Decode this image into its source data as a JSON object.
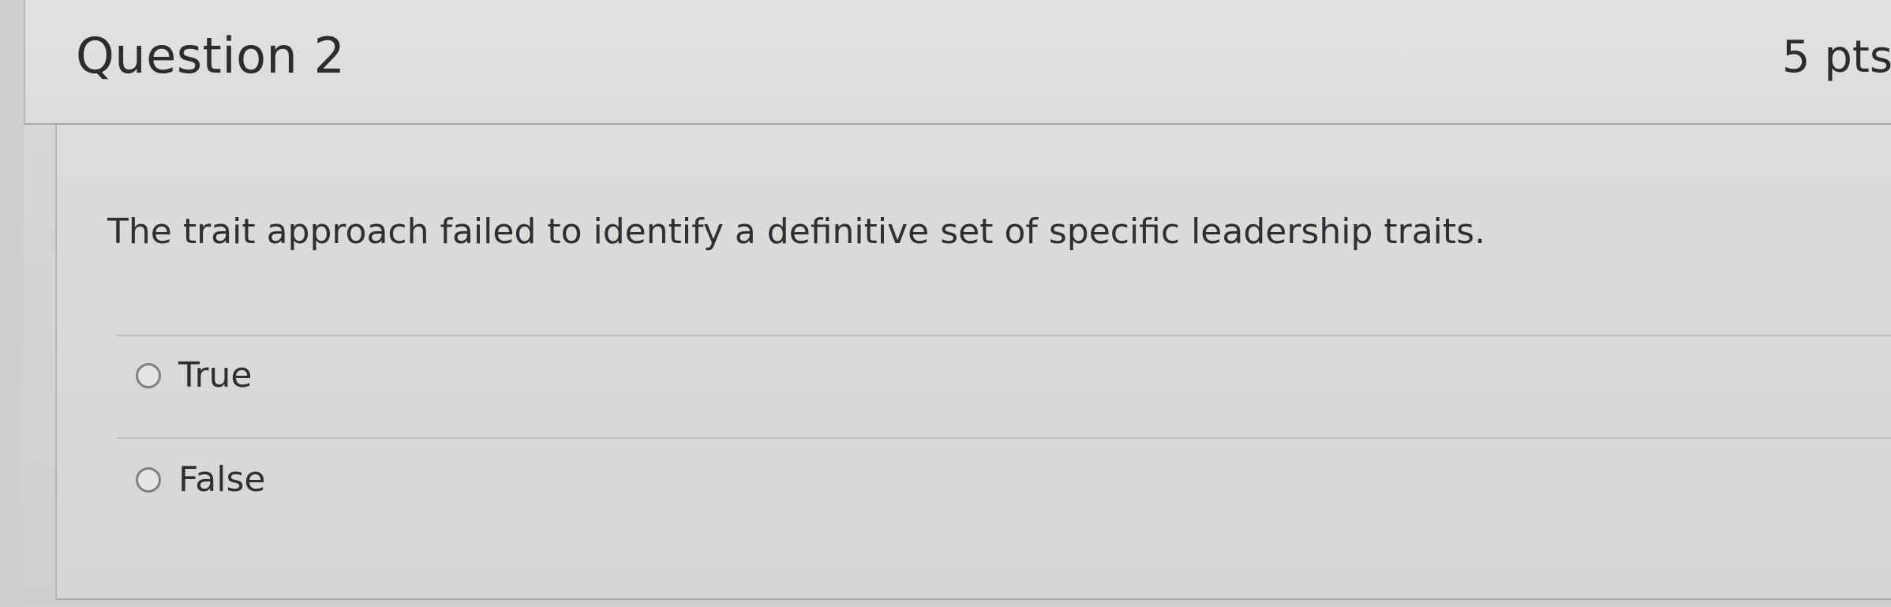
{
  "question": {
    "title": "Question 2",
    "points": "5 pts",
    "text": "The trait approach failed to identify a definitive set of specific leadership traits."
  },
  "answers": [
    {
      "label": "True",
      "selected": false
    },
    {
      "label": "False",
      "selected": false
    }
  ],
  "colors": {
    "background": "#d6d7d5",
    "header": "#dfdfdd",
    "text": "#2b2d31",
    "radio_border": "#7d8084"
  }
}
